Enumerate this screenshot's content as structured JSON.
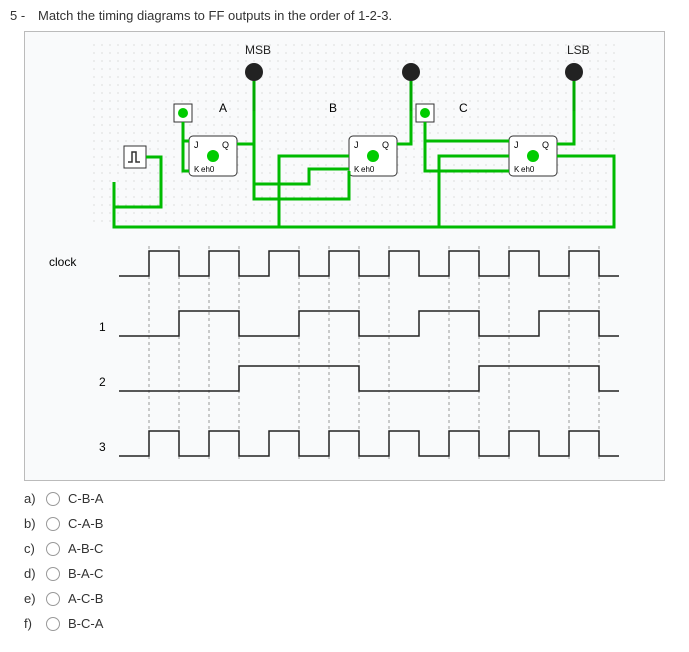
{
  "question": {
    "number": "5 -",
    "text": "Match the timing diagrams to  FF outputs in the order of 1-2-3."
  },
  "circuit": {
    "labels": {
      "msb": "MSB",
      "lsb": "LSB",
      "a": "A",
      "b": "B",
      "c": "C"
    },
    "ff": {
      "j": "J",
      "k": "K",
      "q": "Q",
      "enable": "eh0"
    }
  },
  "timing": {
    "rows": [
      "clock",
      "1",
      "2",
      "3"
    ]
  },
  "options": [
    {
      "label": "a)",
      "text": "C-B-A"
    },
    {
      "label": "b)",
      "text": "C-A-B"
    },
    {
      "label": "c)",
      "text": "A-B-C"
    },
    {
      "label": "d)",
      "text": "B-A-C"
    },
    {
      "label": "e)",
      "text": "A-C-B"
    },
    {
      "label": "f)",
      "text": "B-C-A"
    }
  ],
  "chart_data": {
    "type": "table",
    "description": "Three JK flip-flops A (MSB), B, C (LSB) chained as a ripple/asynchronous counter. Four timing traces: clock (square wave) and outputs 1,2,3 with toggling periods roughly 2x, 4x, 1x the clock period respectively, over 8 clock pulses.",
    "clock_pulses": 8,
    "traces": {
      "clock": [
        0,
        1,
        0,
        1,
        0,
        1,
        0,
        1,
        0,
        1,
        0,
        1,
        0,
        1,
        0,
        1,
        0
      ],
      "1": [
        0,
        0,
        1,
        1,
        0,
        0,
        1,
        1,
        0,
        0,
        1,
        1,
        0,
        0,
        1,
        1,
        0
      ],
      "2": [
        0,
        0,
        0,
        0,
        1,
        1,
        1,
        1,
        0,
        0,
        0,
        0,
        1,
        1,
        1,
        1,
        0
      ],
      "3": [
        0,
        1,
        0,
        1,
        0,
        1,
        0,
        1,
        0,
        1,
        0,
        1,
        0,
        1,
        0,
        1,
        0
      ]
    },
    "answer_mapping_hint": "Fastest toggling = LSB (C), slowest = MSB (A); ordering 1-2-3 → B-A-C"
  }
}
